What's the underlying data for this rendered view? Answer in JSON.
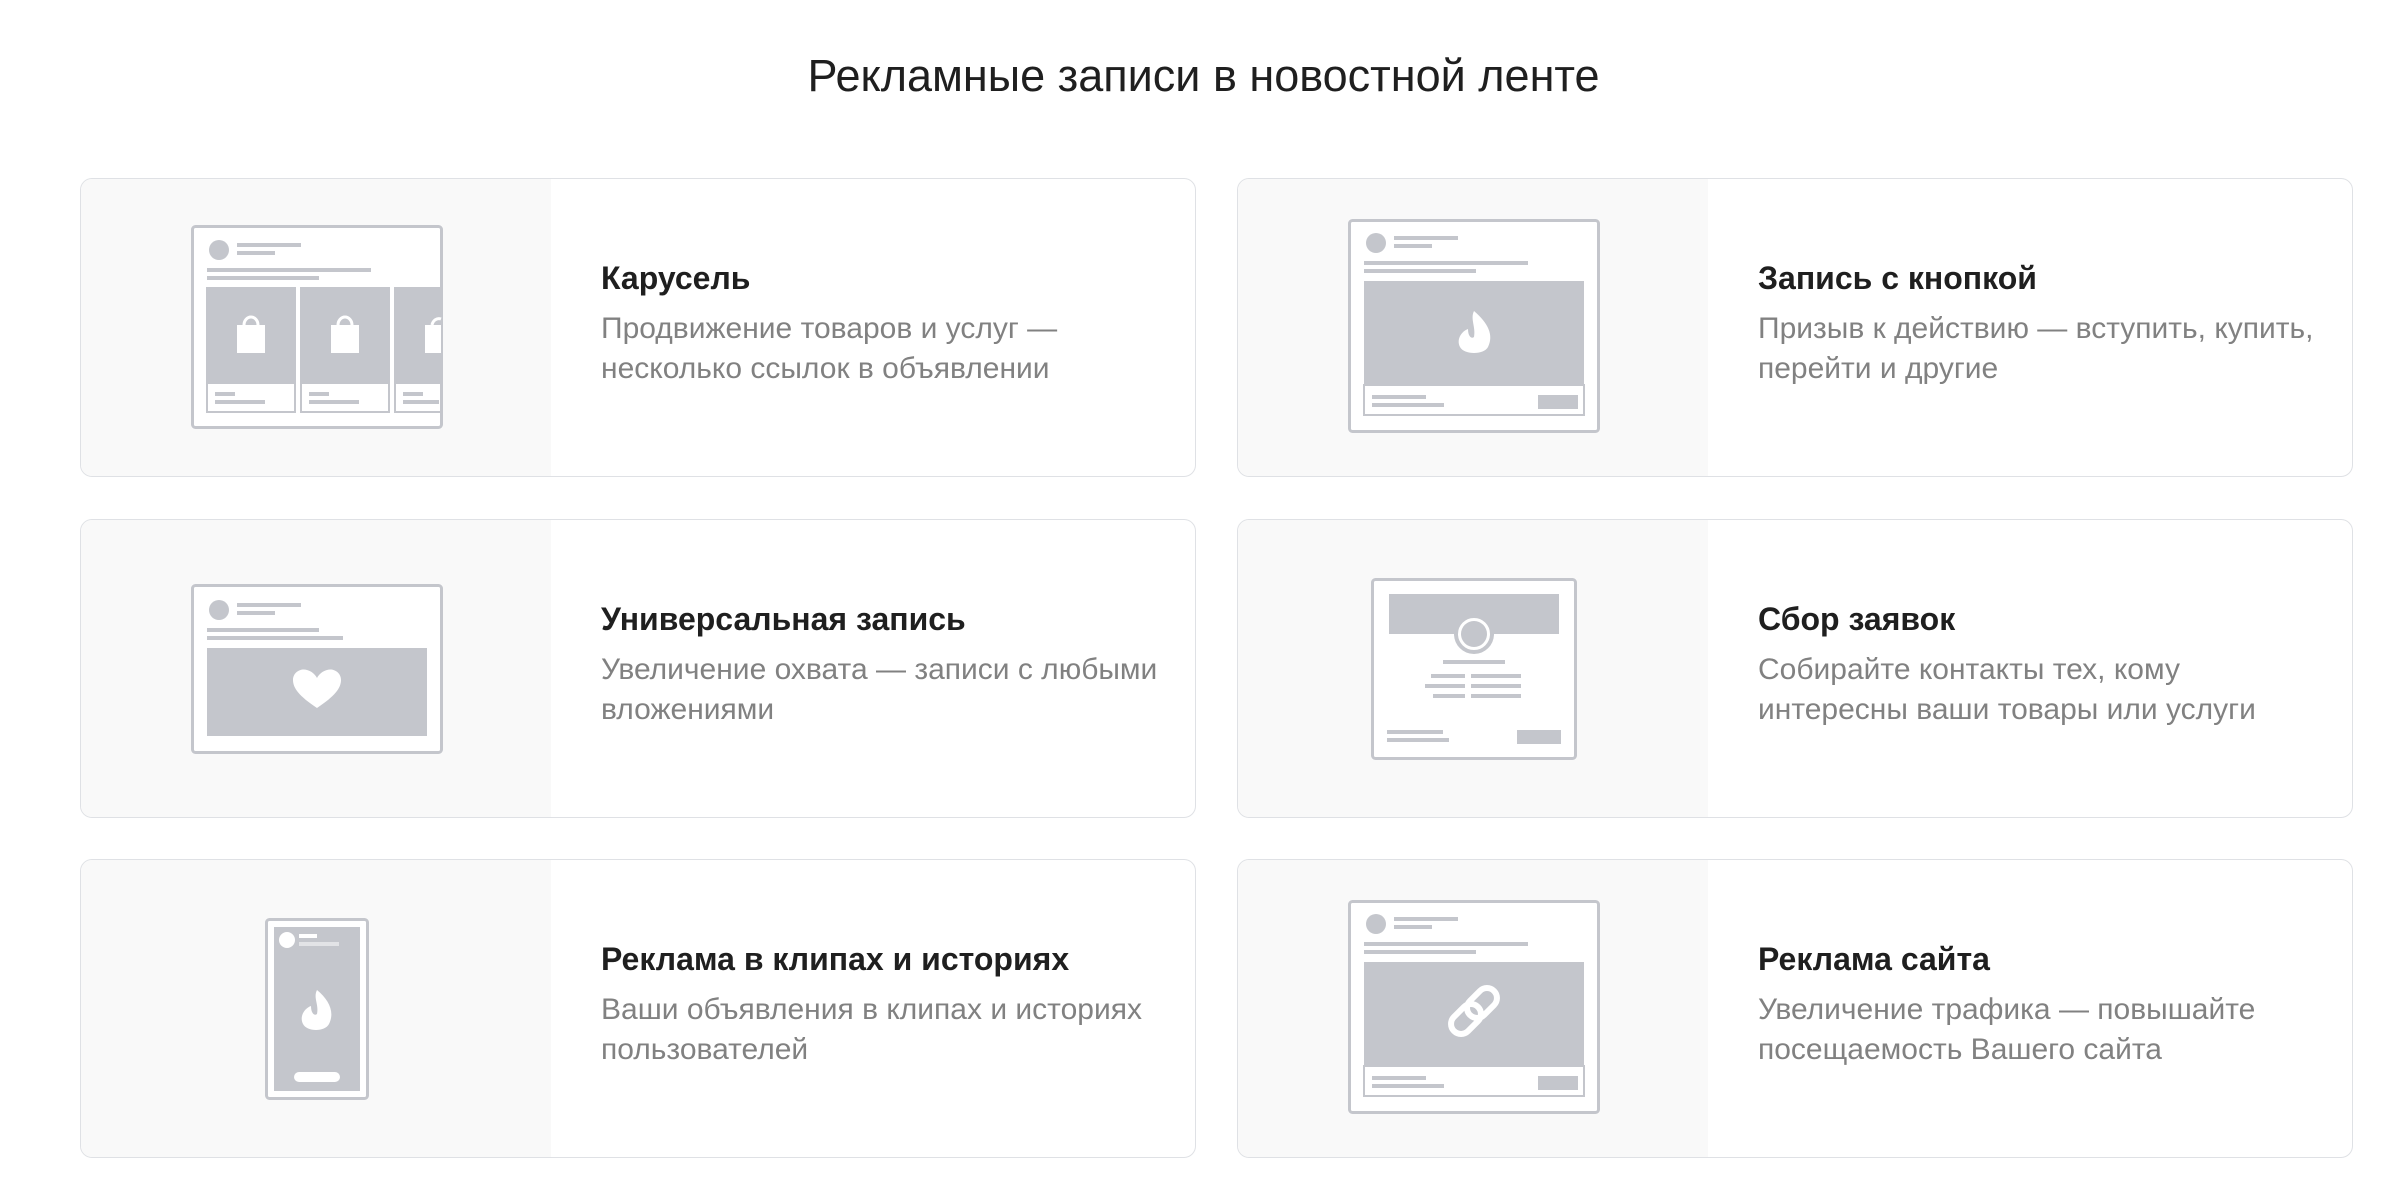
{
  "page": {
    "title": "Рекламные записи в новостной ленте"
  },
  "colors": {
    "background": "#ffffff",
    "card_border": "#dfe1e5",
    "preview_bg": "#f9f9f9",
    "illustration_gray": "#c4c6cc",
    "title_text": "#1f1f1f",
    "desc_text": "#818181"
  },
  "cards": [
    {
      "title": "Карусель",
      "description": "Продвижение товаров и услуг — несколько ссылок в объявлении",
      "icon": "carousel-post-icon"
    },
    {
      "title": "Запись с кнопкой",
      "description": "Призыв к действию — вступить, купить, перейти и другие",
      "icon": "button-post-icon"
    },
    {
      "title": "Универсальная запись",
      "description": "Увеличение охвата — записи с любыми вложениями",
      "icon": "universal-post-icon"
    },
    {
      "title": "Сбор заявок",
      "description": "Собирайте контакты тех, кому интересны ваши товары или услуги",
      "icon": "lead-form-icon"
    },
    {
      "title": "Реклама в клипах и историях",
      "description": "Ваши объявления в клипах и историях пользователей",
      "icon": "stories-clips-icon"
    },
    {
      "title": "Реклама сайта",
      "description": "Увеличение трафика — повышайте посещаемость Вашего сайта",
      "icon": "website-ad-icon"
    }
  ]
}
